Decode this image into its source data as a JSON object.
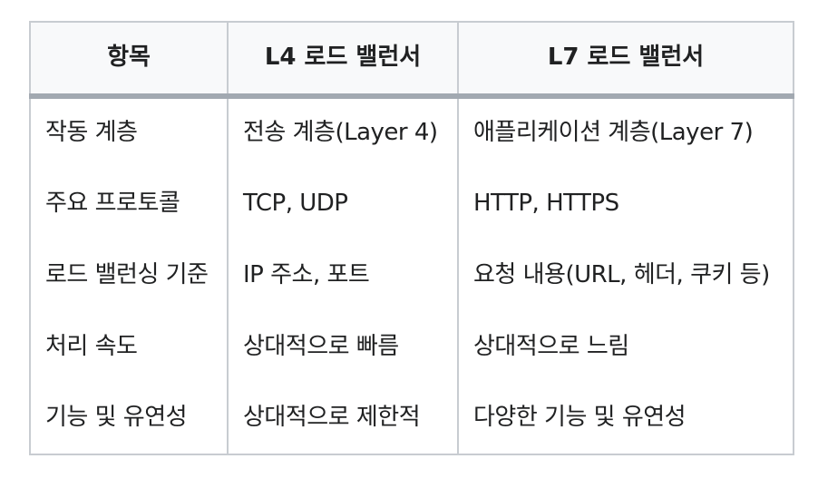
{
  "table": {
    "headers": [
      "항목",
      "L4 로드 밸런서",
      "L7 로드 밸런서"
    ],
    "rows": [
      [
        "작동 계층",
        "전송 계층(Layer 4)",
        "애플리케이션 계층(Layer 7)"
      ],
      [
        "주요 프로토콜",
        "TCP, UDP",
        "HTTP, HTTPS"
      ],
      [
        "로드 밸런싱 기준",
        "IP 주소, 포트",
        "요청 내용(URL, 헤더, 쿠키 등)"
      ],
      [
        "처리 속도",
        "상대적으로 빠름",
        "상대적으로 느림"
      ],
      [
        "기능 및 유연성",
        "상대적으로 제한적",
        "다양한 기능 및 유연성"
      ]
    ]
  },
  "colors": {
    "border": "#c8ccd1",
    "header_bg": "#f8f9fa",
    "header_rule": "#a2a9b1",
    "text": "#202122"
  }
}
